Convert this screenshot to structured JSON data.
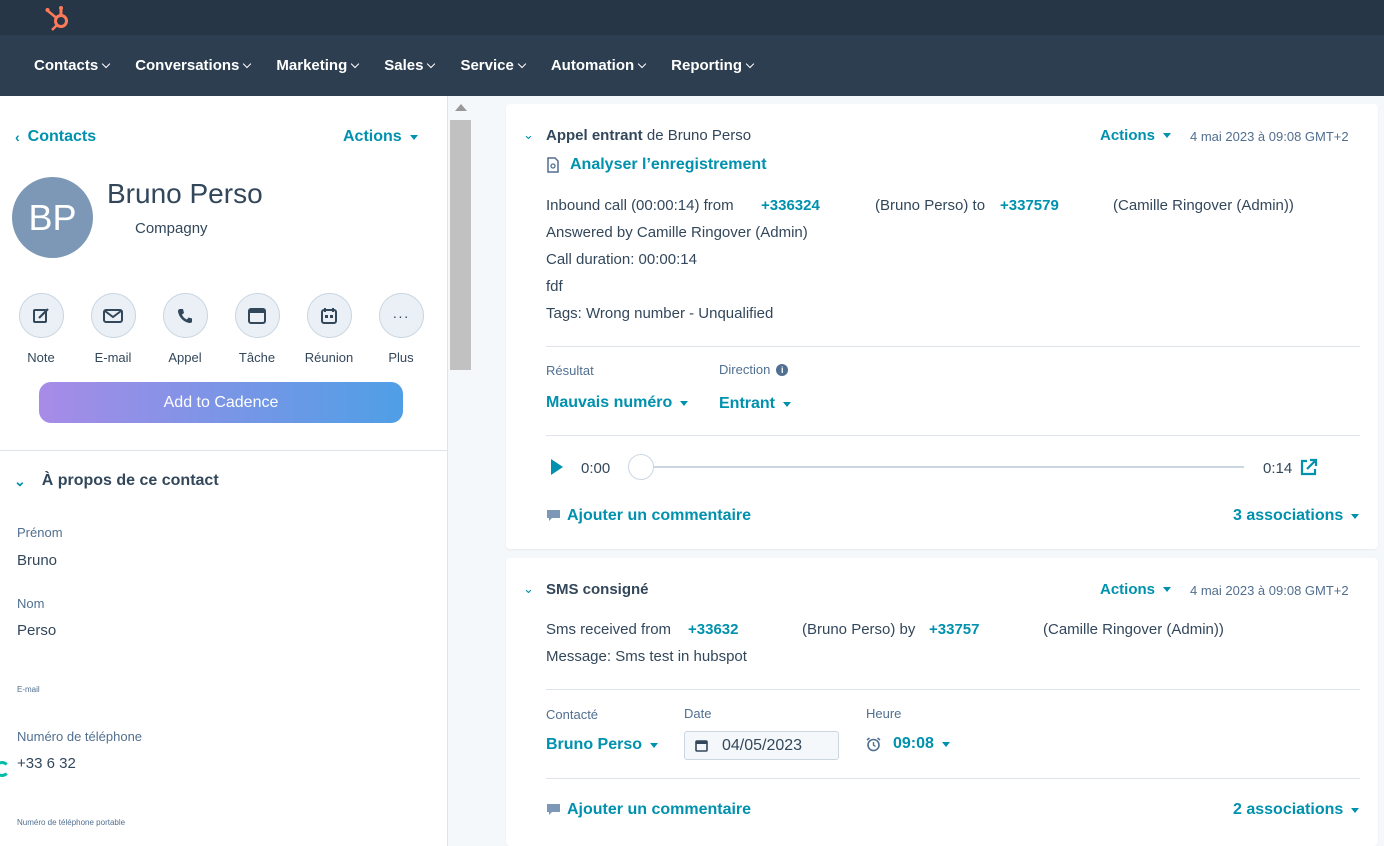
{
  "nav": {
    "items": [
      "Contacts",
      "Conversations",
      "Marketing",
      "Sales",
      "Service",
      "Automation",
      "Reporting"
    ]
  },
  "left": {
    "back_label": "Contacts",
    "actions_label": "Actions",
    "avatar_initials": "BP",
    "name": "Bruno Perso",
    "company": "Compagny",
    "actions": [
      {
        "label": "Note",
        "icon": "edit-icon"
      },
      {
        "label": "E-mail",
        "icon": "email-icon"
      },
      {
        "label": "Appel",
        "icon": "phone-icon"
      },
      {
        "label": "Tâche",
        "icon": "task-icon"
      },
      {
        "label": "Réunion",
        "icon": "calendar-icon"
      },
      {
        "label": "Plus",
        "icon": "more-icon"
      }
    ],
    "cadence_label": "Add to Cadence",
    "about_title": "À propos de ce contact",
    "props": {
      "first_name_label": "Prénom",
      "first_name_value": "Bruno",
      "last_name_label": "Nom",
      "last_name_value": "Perso",
      "email_label": "E-mail",
      "phone_label": "Numéro de téléphone",
      "phone_value": "+33 6 32",
      "mobile_label": "Numéro de téléphone portable"
    }
  },
  "call_card": {
    "title_bold": "Appel entrant",
    "title_rest": " de Bruno Perso",
    "actions_label": "Actions",
    "date": "4 mai 2023 à 09:08 GMT+2",
    "analyze_label": "Analyser l’enregistrement",
    "line1_a": "Inbound call (00:00:14) from ",
    "line1_from": "+336324",
    "line1_b": "(Bruno Perso) to ",
    "line1_to": "+337579",
    "line1_c": "(Camille Ringover (Admin))",
    "line2": "Answered by Camille Ringover (Admin)",
    "line3": "Call duration: 00:00:14",
    "line4": "fdf",
    "line5": "Tags: Wrong number - Unqualified",
    "result_label": "Résultat",
    "result_value": "Mauvais numéro",
    "direction_label": "Direction",
    "direction_value": "Entrant",
    "time_start": "0:00",
    "time_end": "0:14",
    "comment_label": "Ajouter un commentaire",
    "assoc_label": "3 associations"
  },
  "sms_card": {
    "title": "SMS consigné",
    "actions_label": "Actions",
    "date": "4 mai 2023 à 09:08 GMT+2",
    "line1_a": "Sms received from ",
    "line1_from": "+33632",
    "line1_b": "(Bruno Perso) by ",
    "line1_by": "+33757",
    "line1_c": "(Camille Ringover (Admin))",
    "line2": "Message: Sms test in hubspot",
    "contacted_label": "Contacté",
    "contacted_value": "Bruno Perso",
    "date_label": "Date",
    "date_value": "04/05/2023",
    "time_label": "Heure",
    "time_value": "09:08",
    "comment_label": "Ajouter un commentaire",
    "assoc_label": "2 associations"
  },
  "colors": {
    "accent": "#0091ae",
    "nav_bg": "#2d3e50",
    "topbar_bg": "#263646",
    "brand": "#ff7a59"
  }
}
